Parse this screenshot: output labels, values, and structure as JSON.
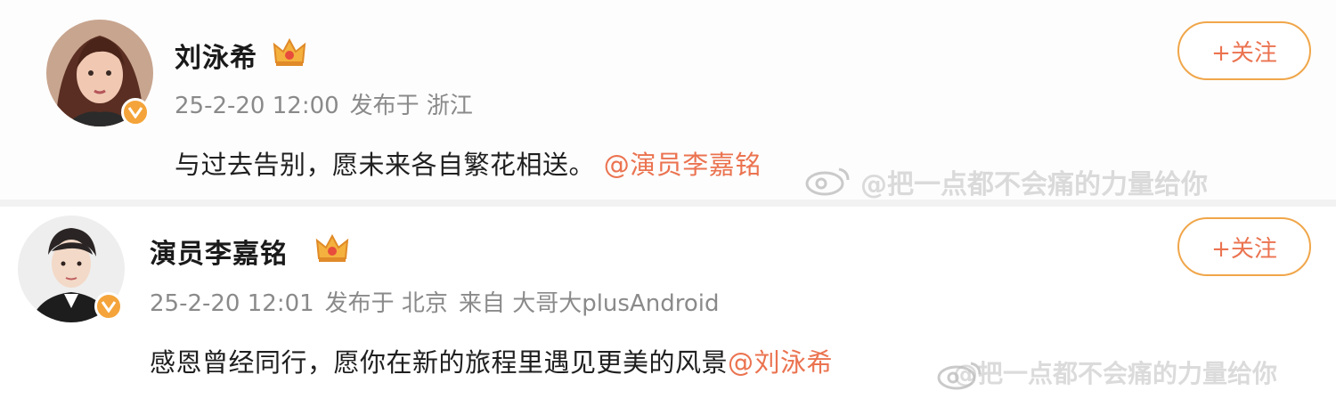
{
  "posts": [
    {
      "author": "刘泳希",
      "time": "25-2-20 12:00",
      "published_from": "发布于 浙江",
      "device": "",
      "text": "与过去告别，愿未来各自繁花相送。",
      "mention": "@演员李嘉铭",
      "follow_label": "+关注",
      "watermark": "@把一点都不会痛的力量给你"
    },
    {
      "author": "演员李嘉铭",
      "time": "25-2-20 12:01",
      "published_from": "发布于 北京",
      "device": "来自 大哥大plusAndroid",
      "text": "感恩曾经同行，愿你在新的旅程里遇见更美的风景",
      "mention": "@刘泳希",
      "follow_label": "+关注",
      "watermark": "@把一点都不会痛的力量给你"
    }
  ],
  "colors": {
    "accent": "#eb7350",
    "badge": "#f4a43a",
    "follow_border": "#f0a64a"
  },
  "icons": [
    "crown-icon",
    "verified-badge-icon",
    "weibo-logo-icon"
  ]
}
